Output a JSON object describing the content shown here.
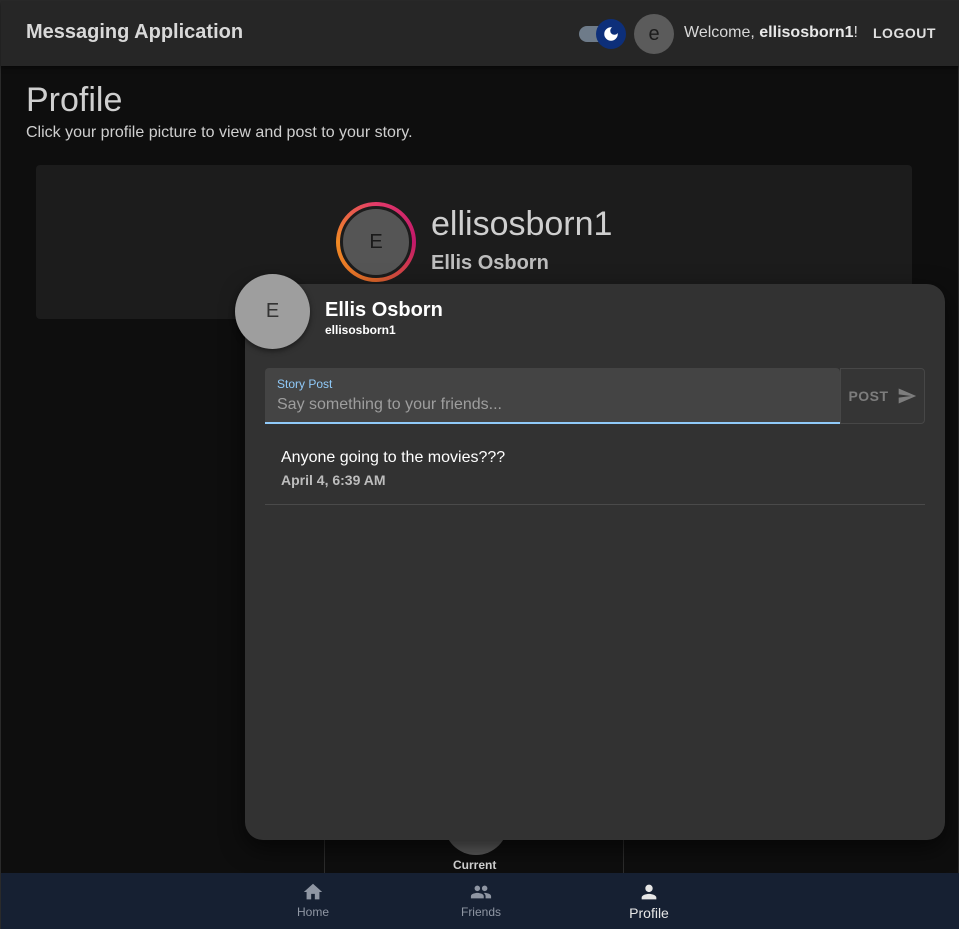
{
  "app_bar": {
    "title": "Messaging Application",
    "avatar_letter": "e",
    "welcome_prefix": "Welcome, ",
    "username": "ellisosborn1",
    "welcome_suffix": "!",
    "logout_label": "LOGOUT"
  },
  "profile": {
    "title": "Profile",
    "subtitle": "Click your profile picture to view and post to your story.",
    "avatar_letter": "E",
    "username": "ellisosborn1",
    "full_name": "Ellis Osborn"
  },
  "story_modal": {
    "avatar_letter": "E",
    "name": "Ellis Osborn",
    "handle": "ellisosborn1",
    "input_label": "Story Post",
    "input_placeholder": "Say something to your friends...",
    "input_value": "",
    "post_label": "POST",
    "posts": [
      {
        "text": "Anyone going to the movies???",
        "time": "April 4, 6:39 AM"
      }
    ]
  },
  "background": {
    "current_label": "Current"
  },
  "bottom_nav": {
    "items": [
      {
        "label": "Home",
        "icon": "home-icon",
        "active": false
      },
      {
        "label": "Friends",
        "icon": "people-icon",
        "active": false
      },
      {
        "label": "Profile",
        "icon": "person-icon",
        "active": true
      }
    ]
  },
  "colors": {
    "app_bar": "#262626",
    "modal": "#323232",
    "accent": "#90caf9",
    "bottom_nav": "#162032",
    "toggle_thumb": "#0d2f7a"
  }
}
